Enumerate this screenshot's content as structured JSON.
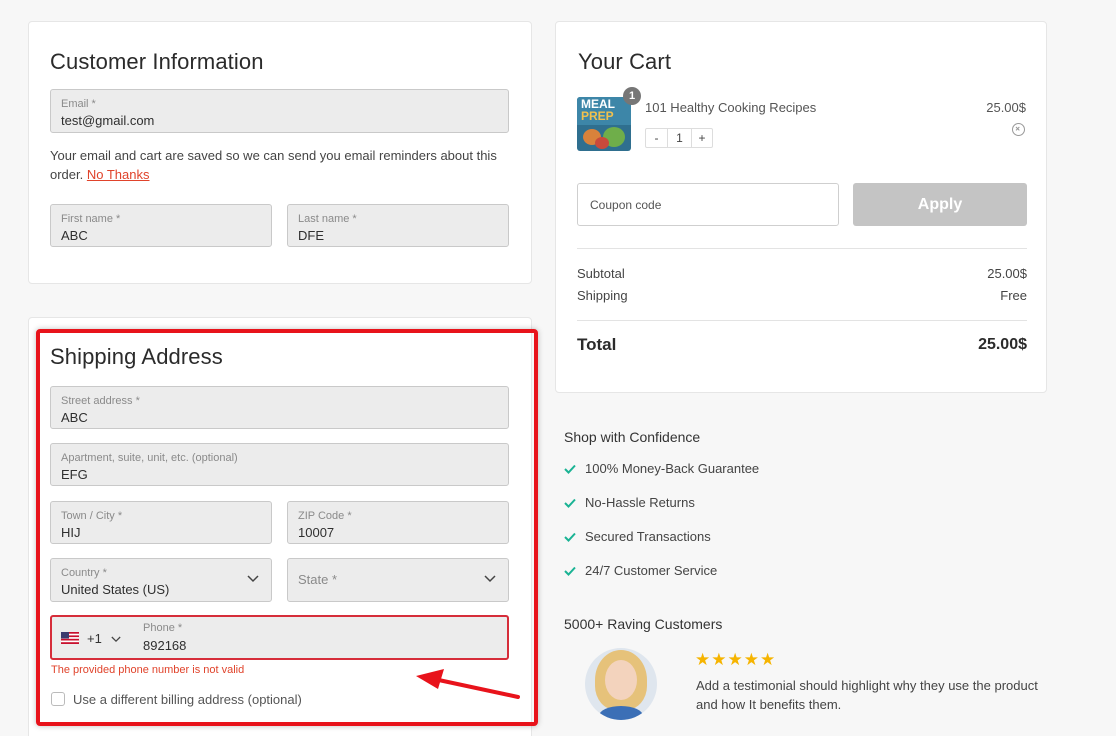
{
  "customer": {
    "title": "Customer Information",
    "email_label": "Email *",
    "email_value": "test@gmail.com",
    "note_text": "Your email and cart are saved so we can send you email reminders about this order.",
    "no_thanks": "No Thanks",
    "first_label": "First name *",
    "first_value": "ABC",
    "last_label": "Last name *",
    "last_value": "DFE"
  },
  "shipping": {
    "title": "Shipping Address",
    "street_label": "Street address *",
    "street_value": "ABC",
    "apt_label": "Apartment, suite, unit, etc. (optional)",
    "apt_value": "EFG",
    "city_label": "Town / City *",
    "city_value": "HIJ",
    "zip_label": "ZIP Code *",
    "zip_value": "10007",
    "country_label": "Country *",
    "country_value": "United States (US)",
    "state_placeholder": "State *",
    "phone_code": "+1",
    "phone_label": "Phone *",
    "phone_value": "892168",
    "phone_error": "The provided phone number is not valid",
    "billing_label": "Use a different billing address (optional)"
  },
  "cart": {
    "title": "Your Cart",
    "item_name": "101 Healthy Cooking Recipes",
    "item_price": "25.00$",
    "item_qty": "1",
    "badge": "1",
    "qty_minus": "-",
    "qty_plus": "+",
    "coupon_placeholder": "Coupon code",
    "apply_label": "Apply",
    "subtotal_label": "Subtotal",
    "subtotal_value": "25.00$",
    "shipping_label": "Shipping",
    "shipping_value": "Free",
    "total_label": "Total",
    "total_value": "25.00$",
    "book_cover_text_1": "MEAL",
    "book_cover_text_2": "PREP"
  },
  "confidence": {
    "title": "Shop with Confidence",
    "items": [
      "100% Money-Back Guarantee",
      "No-Hassle Returns",
      "Secured Transactions",
      "24/7 Customer Service"
    ]
  },
  "reviews": {
    "title": "5000+ Raving Customers",
    "stars": "★★★★★",
    "rating": 5,
    "line1": "Add a testimonial should highlight why they use the product",
    "line2": "and how It benefits them."
  },
  "colors": {
    "highlight": "#e8131b",
    "error": "#e0432b",
    "check": "#1ab394",
    "star": "#f6b400"
  },
  "icons": [
    "us-flag-icon",
    "chevron-down-icon",
    "remove-item-icon",
    "checkmark-icon",
    "red-arrow-annotation"
  ]
}
